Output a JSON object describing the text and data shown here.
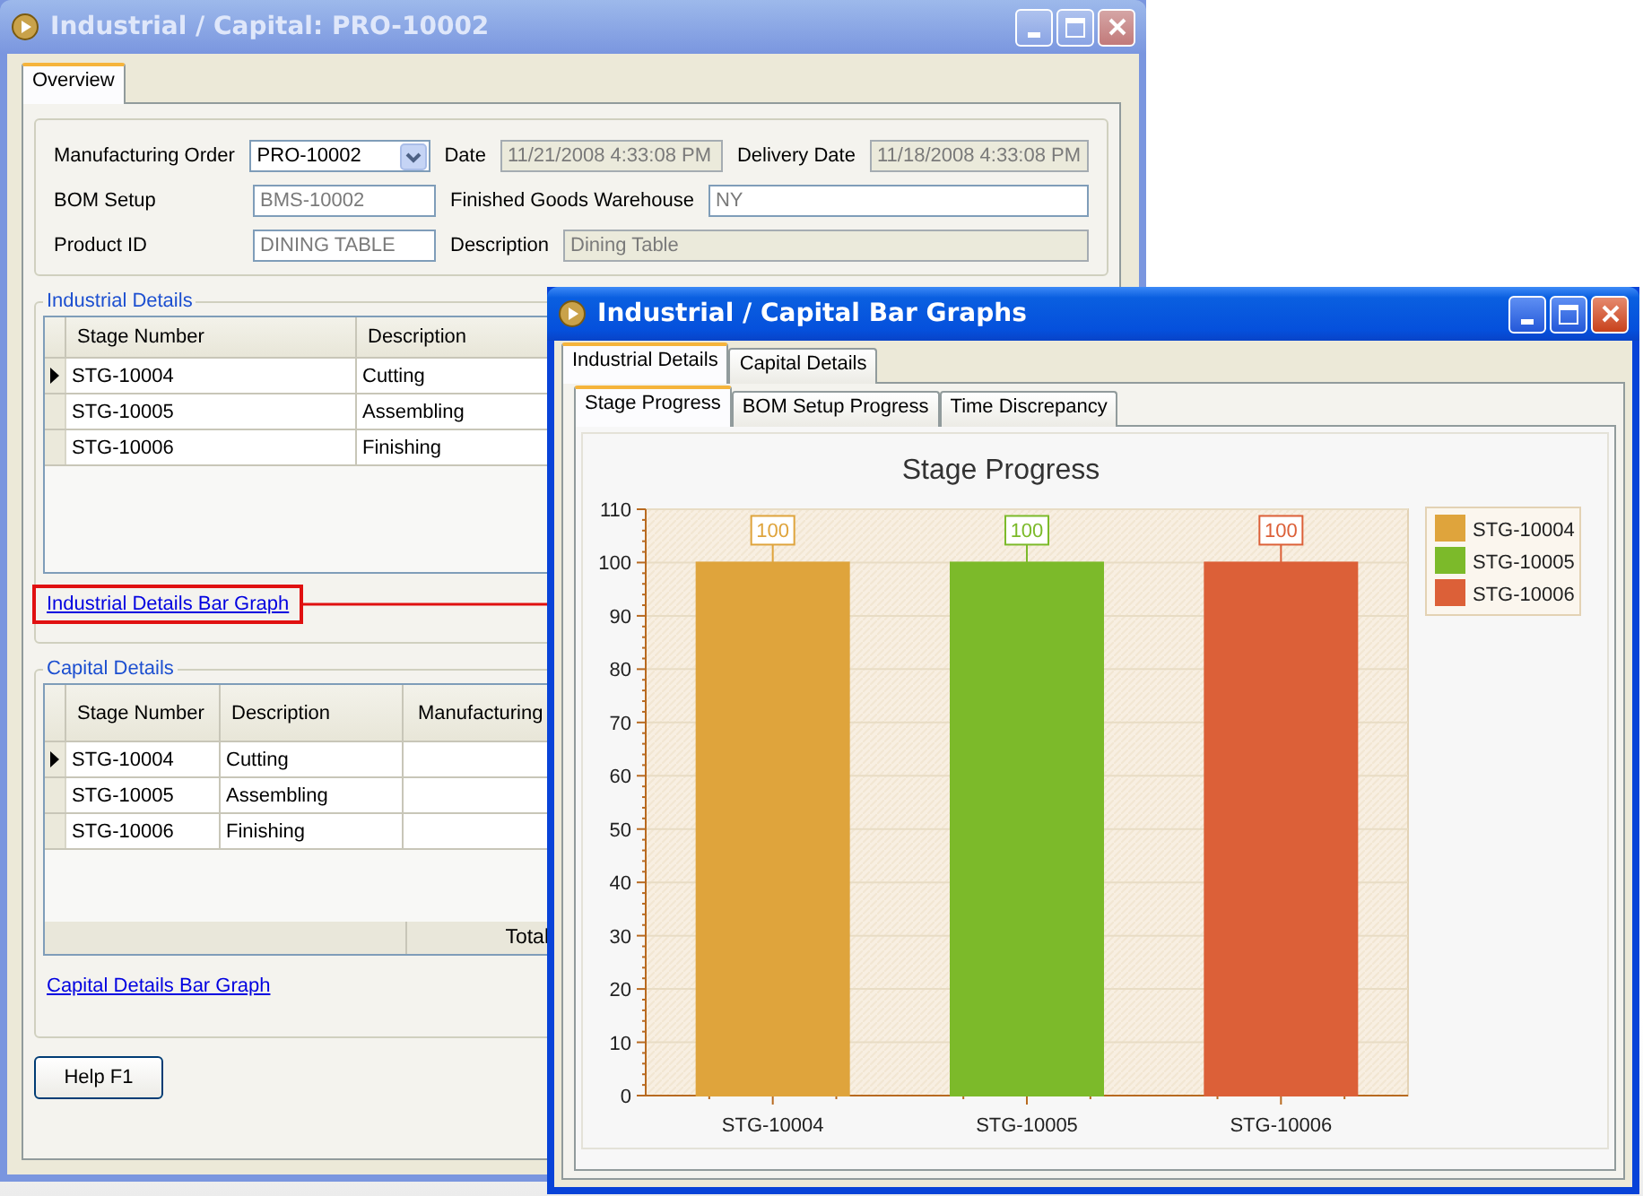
{
  "main_window": {
    "title": "Industrial / Capital: PRO-10002",
    "active": false,
    "tabs": [
      {
        "label": "Overview",
        "selected": true
      }
    ],
    "form": {
      "rows": [
        {
          "fields": [
            {
              "label": "Manufacturing Order",
              "value": "PRO-10002",
              "kind": "dropdown",
              "disabled": false
            },
            {
              "label": "Date",
              "value": "11/21/2008 4:33:08 PM",
              "kind": "text",
              "disabled": true
            },
            {
              "label": "Delivery Date",
              "value": "11/18/2008 4:33:08 PM",
              "kind": "text",
              "disabled": true
            }
          ]
        },
        {
          "fields": [
            {
              "label": "BOM Setup",
              "value": "BMS-10002",
              "kind": "text",
              "disabled": false
            },
            {
              "label": "Finished Goods Warehouse",
              "value": "NY",
              "kind": "text",
              "disabled": false
            }
          ]
        },
        {
          "fields": [
            {
              "label": "Product ID",
              "value": "DINING TABLE",
              "kind": "text",
              "disabled": false
            },
            {
              "label": "Description",
              "value": "Dining Table",
              "kind": "text",
              "disabled": true
            }
          ]
        }
      ]
    },
    "industrial_details": {
      "title": "Industrial Details",
      "columns": [
        "Stage Number",
        "Description"
      ],
      "rows": [
        {
          "cells": [
            "STG-10004",
            "Cutting"
          ],
          "selected": true
        },
        {
          "cells": [
            "STG-10005",
            "Assembling"
          ],
          "selected": false
        },
        {
          "cells": [
            "STG-10006",
            "Finishing"
          ],
          "selected": false
        }
      ],
      "link": {
        "label": "Industrial Details Bar Graph",
        "highlighted": true
      }
    },
    "capital_details": {
      "title": "Capital Details",
      "columns": [
        "Stage Number",
        "Description",
        "Manufacturing"
      ],
      "rows": [
        {
          "cells": [
            "STG-10004",
            "Cutting"
          ],
          "selected": true
        },
        {
          "cells": [
            "STG-10005",
            "Assembling"
          ],
          "selected": false
        },
        {
          "cells": [
            "STG-10006",
            "Finishing"
          ],
          "selected": false
        }
      ],
      "footer": "Total",
      "link": {
        "label": "Capital Details Bar Graph",
        "highlighted": false
      }
    },
    "button": "Help F1"
  },
  "graph_window": {
    "title": "Industrial / Capital Bar Graphs",
    "active": true,
    "tabs": [
      {
        "label": "Industrial Details",
        "selected": true
      },
      {
        "label": "Capital Details",
        "selected": false
      }
    ],
    "subtabs": [
      {
        "label": "Stage Progress",
        "selected": true
      },
      {
        "label": "BOM Setup Progress",
        "selected": false
      },
      {
        "label": "Time Discrepancy",
        "selected": false
      }
    ],
    "chart_data": {
      "type": "bar",
      "title": "Stage Progress",
      "categories": [
        "STG-10004",
        "STG-10005",
        "STG-10006"
      ],
      "series": [
        {
          "name": "STG-10004",
          "color": "#dfa43c",
          "values": [
            100,
            null,
            null
          ]
        },
        {
          "name": "STG-10005",
          "color": "#7cba2a",
          "values": [
            null,
            100,
            null
          ]
        },
        {
          "name": "STG-10006",
          "color": "#dc6038",
          "values": [
            null,
            null,
            100
          ]
        }
      ],
      "grid": true,
      "legend": true,
      "ylim": [
        0,
        110
      ],
      "yticks": [
        0,
        10,
        20,
        30,
        40,
        50,
        60,
        70,
        80,
        90,
        100,
        110
      ],
      "data_labels": true
    }
  }
}
